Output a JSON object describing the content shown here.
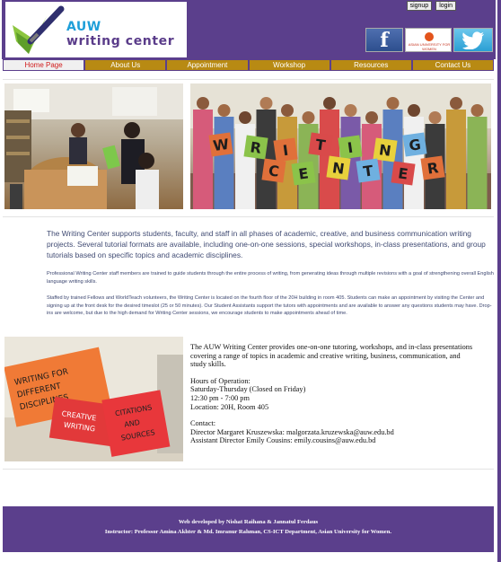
{
  "header": {
    "logo": {
      "line1": "AUW",
      "line2": "writing center"
    },
    "top_links": [
      "signup",
      "login"
    ],
    "social": {
      "facebook_glyph": "f",
      "asian_univ_text": "ASIAN UNIVERSITY FOR WOMEN"
    }
  },
  "nav": {
    "items": [
      "Home Page",
      "About Us",
      "Appointment",
      "Workshop",
      "Resources",
      "Contact Us"
    ],
    "active": "Home Page"
  },
  "main": {
    "lead": "The Writing Center supports students, faculty, and staff in all phases of academic, creative, and business communication writing projects. Several tutorial formats are available, including one-on-one sessions, special workshops, in-class presentations, and group tutorials based on specific topics and academic disciplines.",
    "para1": "Professional Writing Center staff members are trained to guide students through the entire process of writing, from generating ideas through multiple revisions with a goal of strengthening overall English language writing skills.",
    "para2": "Staffed by trained Fellows and WorldTeach volunteers, the Writing Center is located on the fourth floor of the 20H building in room 405. Students can make an appointment by visiting the Center and signing up at the front desk for the desired timeslot (25 or 50 minutes). Our Student Assistants support the tutors with appointments and are available to answer any questions students may have. Drop-ins are welcome, but due to the high demand for Writing Center sessions, we encourage students to make appointments ahead of time.",
    "photo_letters": [
      "W",
      "R",
      "I",
      "T",
      "I",
      "N",
      "G",
      "C",
      "E",
      "N",
      "T",
      "E",
      "R"
    ],
    "book_sign_texts": [
      "WRITING FOR DIFFERENT DISCIPLINES",
      "CREATIVE WRITING",
      "CITATIONS AND SOURCES"
    ]
  },
  "info": {
    "intro": "The AUW Writing Center provides one-on-one tutoring, workshops, and in-class presentations covering a range of topics in academic and creative writing, business, communication, and study skills.",
    "hours_title": "Hours of Operation:",
    "hours_days": "Saturday-Thursday (Closed on Friday)",
    "hours_time": "12:30 pm - 7:00 pm",
    "location": "Location: 20H, Room 405",
    "contact_title": "Contact:",
    "director": "Director Margaret Kruszewska: malgorzata.kruzewska@auw.edu.bd",
    "assistant": "Assistant Director Emily Cousins: emily.cousins@auw.edu.bd"
  },
  "footer": {
    "line1": "Web developed by Nishat Raihana & Jannatul Ferdaus",
    "line2": "Instructor: Professor Amina Akhter & Md. Imranur Rahman, CS-ICT Department, Asian University for Women."
  },
  "colors": {
    "purple": "#5b3f8c",
    "nav_gold": "#b88a13",
    "nav_active_text": "#d01a1a",
    "text_blue": "#404b73"
  }
}
